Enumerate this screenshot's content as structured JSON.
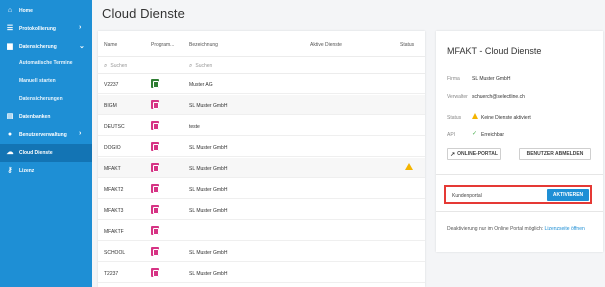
{
  "sidebar": {
    "items": [
      {
        "label": "Home",
        "icon": "home-icon"
      },
      {
        "label": "Protokollierung",
        "icon": "list-icon"
      },
      {
        "label": "Datensicherung",
        "icon": "folder-icon"
      },
      {
        "label": "Automatische Termine"
      },
      {
        "label": "Manuell starten"
      },
      {
        "label": "Datensicherungen"
      },
      {
        "label": "Datenbanken",
        "icon": "database-icon"
      },
      {
        "label": "Benutzerverwaltung",
        "icon": "user-icon"
      },
      {
        "label": "Cloud Dienste",
        "icon": "cloud-icon"
      },
      {
        "label": "Lizenz",
        "icon": "key-icon"
      }
    ],
    "bg_color": "#1e8fd5"
  },
  "page": {
    "title": "Cloud Dienste"
  },
  "table": {
    "headers": [
      "Name",
      "Program...",
      "Bezeichnung",
      "Aktive Dienste",
      "Status"
    ],
    "search_placeholder_1": "Suchen",
    "search_placeholder_2": "Suchen",
    "rows": [
      {
        "name": "V2237",
        "icon_color": "#2e7d32",
        "bez": "Muster AG"
      },
      {
        "name": "BIGM",
        "icon_color": "#d63384",
        "bez": "SL Muster GmbH"
      },
      {
        "name": "DEUTSC",
        "icon_color": "#d63384",
        "bez": "teste"
      },
      {
        "name": "DOGIO",
        "icon_color": "#d63384",
        "bez": "SL Muster GmbH"
      },
      {
        "name": "MFAKT",
        "icon_color": "#d63384",
        "bez": "SL Muster GmbH",
        "status": "warning"
      },
      {
        "name": "MFAKT2",
        "icon_color": "#d63384",
        "bez": "SL Muster GmbH"
      },
      {
        "name": "MFAKT3",
        "icon_color": "#d63384",
        "bez": "SL Muster GmbH"
      },
      {
        "name": "MFAKTF",
        "icon_color": "#d63384",
        "bez": ""
      },
      {
        "name": "SCHOOL",
        "icon_color": "#d63384",
        "bez": "SL Muster GmbH"
      },
      {
        "name": "T2237",
        "icon_color": "#d63384",
        "bez": "SL Muster GmbH"
      }
    ]
  },
  "detail": {
    "title": "MFAKT - Cloud Dienste",
    "firma_label": "Firma",
    "firma_value": "SL Muster GmbH",
    "verwalter_label": "Verwalter",
    "verwalter_value": "schuerch@selectline.ch",
    "status_label": "Status",
    "status_value": "Keine Dienste aktiviert",
    "api_label": "API",
    "api_value": "Erreichbar",
    "online_portal_button": "ONLINE-PORTAL",
    "logout_button": "BENUTZER ABMELDEN",
    "kundenportal_label": "Kundenportal",
    "activate_button": "AKTIVIEREN",
    "note_text": "Deaktivierung nur im Online Portal möglich: ",
    "note_link": "Lizenzseite öffnen",
    "accent_color": "#1e8fd5",
    "highlight_color": "#e53935"
  }
}
